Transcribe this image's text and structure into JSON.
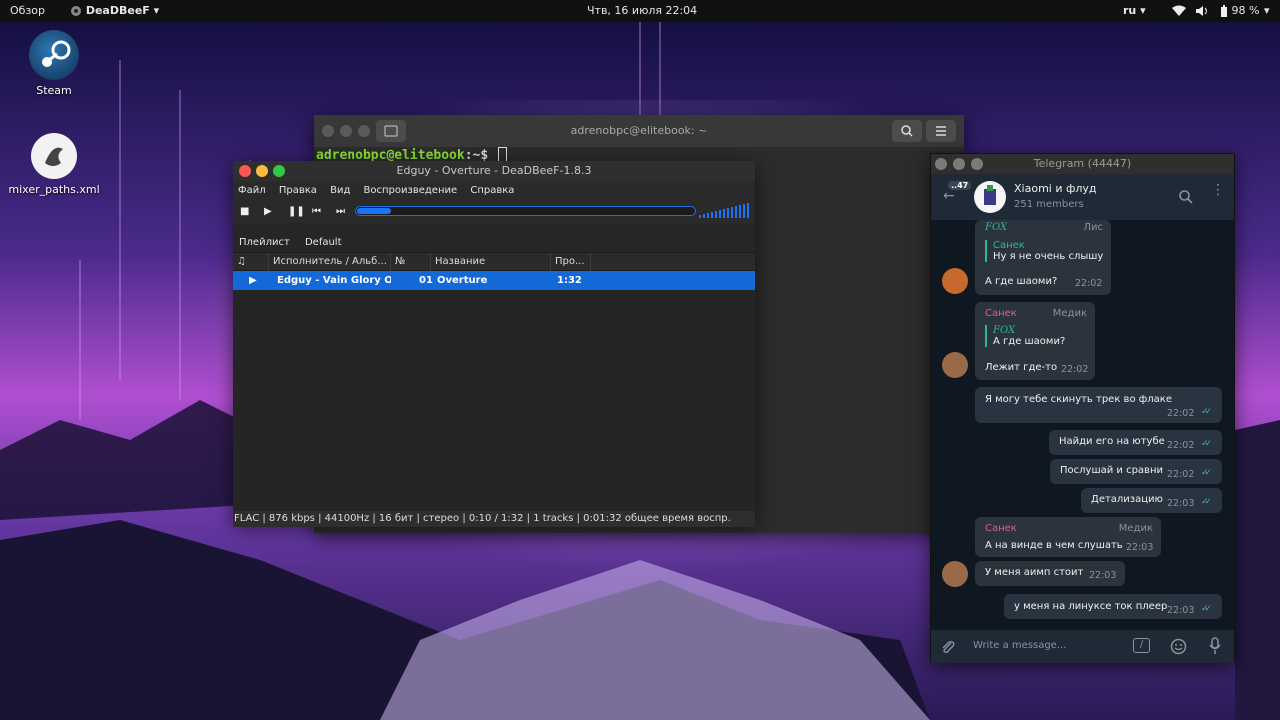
{
  "topbar": {
    "overview": "Обзор",
    "app_name": "DeaDBeeF",
    "datetime": "Чтв, 16 июля  22:04",
    "lang": "ru",
    "battery": "98 %"
  },
  "desktop": {
    "icons": [
      {
        "label": "Steam",
        "icon": "steam-icon"
      },
      {
        "label": "mixer_paths.xml",
        "icon": "xml-file-icon"
      }
    ]
  },
  "terminal": {
    "title": "adrenobpc@elitebook: ~",
    "prompt_user": "adrenobpc@elitebook",
    "prompt_sep": ":~$"
  },
  "deadbeef": {
    "title": "Edguy - Overture - DeaDBeeF-1.8.3",
    "menu": [
      "Файл",
      "Правка",
      "Вид",
      "Воспроизведение",
      "Справка"
    ],
    "progress_fraction": 0.1,
    "playlist_label": "Плейлист",
    "playlist_name": "Default",
    "columns": [
      "♫",
      "Исполнитель / Альб...",
      "№",
      "Название",
      "Про..."
    ],
    "tracks": [
      {
        "artist_album": "Edguy - Vain Glory O...",
        "num": "01",
        "title": "Overture",
        "duration": "1:32"
      }
    ],
    "status": "FLAC | 876 kbps | 44100Hz | 16 бит | стерео | 0:10 / 1:32 | 1 tracks | 0:01:32 общее время воспр."
  },
  "telegram": {
    "title": "Telegram (44447)",
    "back_count": "..47",
    "chat_name": "Xiaomi и флуд",
    "members": "251 members",
    "input_placeholder": "Write a message...",
    "messages": [
      {
        "quote_name": "FOX",
        "reply_name": "Санек",
        "reply_text": "Ну я не очень слышу",
        "text": "А где шаоми?",
        "time": "22:02",
        "role": "Лис"
      },
      {
        "name": "Санек",
        "role": "Медик",
        "quote_name": "FOX",
        "reply_text": "А где шаоми?",
        "text": "Лежит где-то",
        "time": "22:02"
      },
      {
        "text": "Я могу тебе скинуть трек во флаке",
        "time": "22:02",
        "outgoing": true
      },
      {
        "text": "Найди его на ютубе",
        "time": "22:02",
        "outgoing": true
      },
      {
        "text": "Послушай и сравни",
        "time": "22:02",
        "outgoing": true
      },
      {
        "text": "Детализацию",
        "time": "22:03",
        "outgoing": true
      },
      {
        "name": "Санек",
        "role": "Медик",
        "text": "А на винде в чем слушать",
        "time": "22:03"
      },
      {
        "text": "У меня аимп стоит",
        "time": "22:03"
      },
      {
        "text": "у меня на линуксе ток плеер",
        "time": "22:03",
        "outgoing": true
      }
    ]
  },
  "colors": {
    "accent_blue": "#1469d8",
    "telegram_bg": "#0f1720",
    "telegram_name": "#e05e87",
    "quote_green": "#2fb4a0",
    "terminal_prompt_green": "#8ae234"
  }
}
